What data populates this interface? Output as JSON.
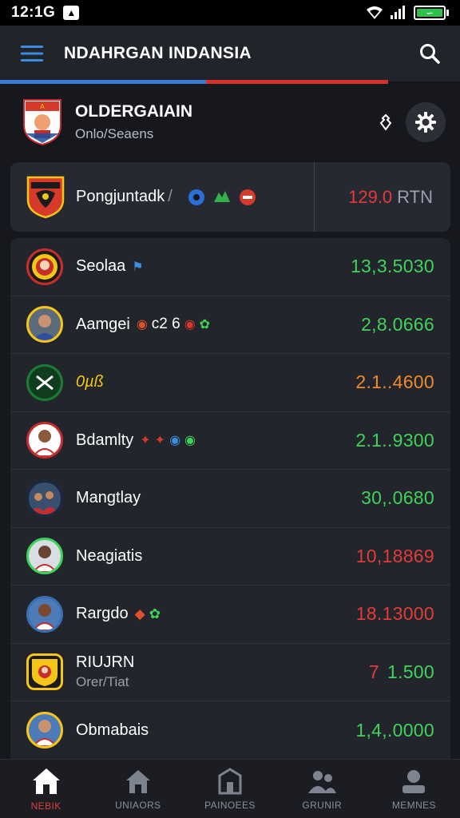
{
  "status_bar": {
    "time": "12:1G",
    "notification_icon": "notification-icon",
    "battery_text": ""
  },
  "app_bar": {
    "title": "NDAHRGAN INDANSIA",
    "menu_icon": "hamburger-menu-icon",
    "search_icon": "search-icon"
  },
  "league": {
    "name": "OLDERGAIAIN",
    "subtitle": "Onlo/Seaens",
    "filter_icon": "puzzle-icon",
    "settings_icon": "gear-icon"
  },
  "featured": {
    "name": "Pongjuntadk",
    "slash": "/",
    "value": "129.0",
    "currency": "RTN"
  },
  "rows": [
    {
      "name": "Seolaa",
      "sub": "",
      "value": "13,3.5030",
      "color": "#3fd35a"
    },
    {
      "name": "Aamgei",
      "extra": "c2 6",
      "sub": "",
      "value": "2,8.0666",
      "color": "#3fd35a"
    },
    {
      "name": "",
      "script": "0µß",
      "sub": "",
      "value": "2.1..4600",
      "color": "#f08a2c"
    },
    {
      "name": "Bdamlty",
      "sub": "",
      "value": "2.1..9300",
      "color": "#3fd35a"
    },
    {
      "name": "Mangtlay",
      "sub": "",
      "value": "30,.0680",
      "color": "#3fd35a"
    },
    {
      "name": "Neagiatis",
      "sub": "",
      "value": "10,18869",
      "color": "#e33b38"
    },
    {
      "name": "Rargdo",
      "sub": "",
      "value": "18.13000",
      "color": "#e33b38"
    },
    {
      "name": "RIUJRN",
      "sub": "Orer/Tiat",
      "value": "7",
      "value2": "1.500",
      "color": "#e33b38",
      "color2": "#3fd35a"
    },
    {
      "name": "Obmabais",
      "sub": "",
      "value": "1,4,.0000",
      "color": "#3fd35a"
    }
  ],
  "nav": [
    {
      "label": "NEBIK",
      "icon": "home-icon",
      "active": true
    },
    {
      "label": "UNIAORS",
      "icon": "house-icon",
      "active": false
    },
    {
      "label": "PAINOEES",
      "icon": "building-icon",
      "active": false
    },
    {
      "label": "GRUNIR",
      "icon": "group-icon",
      "active": false
    },
    {
      "label": "MEMNES",
      "icon": "profile-icon",
      "active": false
    }
  ],
  "colors": {
    "accent_blue": "#3a7bd5",
    "accent_red": "#d6322b",
    "positive": "#3fd35a",
    "negative": "#e33b38",
    "warning": "#f08a2c"
  }
}
